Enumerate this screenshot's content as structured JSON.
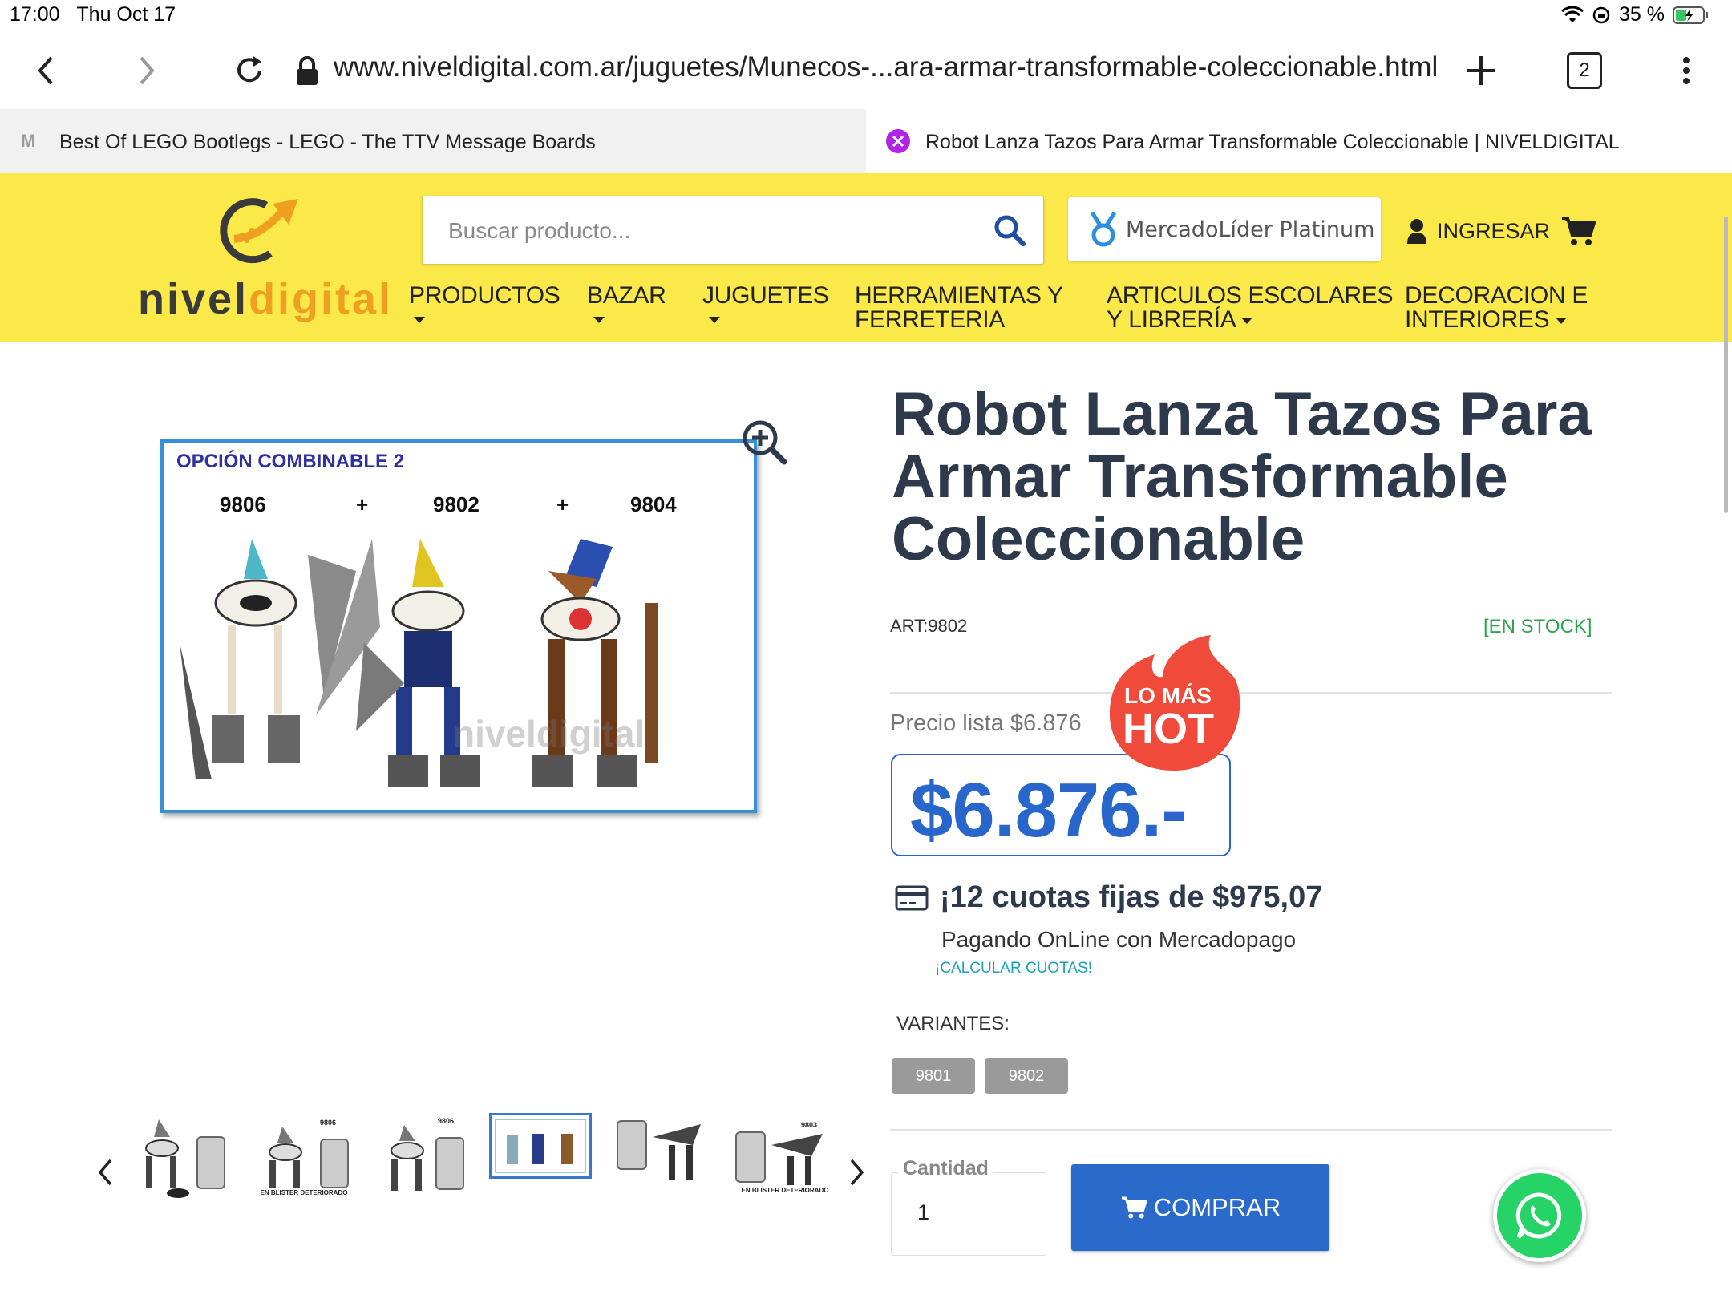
{
  "status_bar": {
    "time": "17:00",
    "date": "Thu Oct 17",
    "battery": "35 %"
  },
  "browser": {
    "url": "www.niveldigital.com.ar/juguetes/Munecos-...ara-armar-transformable-coleccionable.html",
    "tab_count": "2",
    "tabs": [
      {
        "title": "Best Of LEGO Bootlegs - LEGO - The TTV Message Boards",
        "favicon": "M"
      },
      {
        "title": "Robot Lanza Tazos Para Armar Transformable Coleccionable | NIVELDIGITAL"
      }
    ]
  },
  "header": {
    "logo": {
      "nivel": "nivel",
      "digital": "digital"
    },
    "search_placeholder": "Buscar producto...",
    "badge": "MercadoLíder Platinum",
    "login": "INGRESAR",
    "nav": [
      {
        "line1": "PRODUCTOS",
        "line2": ""
      },
      {
        "line1": "BAZAR",
        "line2": ""
      },
      {
        "line1": "JUGUETES",
        "line2": ""
      },
      {
        "line1": "HERRAMIENTAS Y",
        "line2": "FERRETERIA"
      },
      {
        "line1": "ARTICULOS ESCOLARES",
        "line2": "Y LIBRERÍA"
      },
      {
        "line1": "DECORACION E",
        "line2": "INTERIORES"
      }
    ]
  },
  "product": {
    "title": "Robot Lanza Tazos Para Armar Transformable Coleccionable",
    "art": "ART:9802",
    "stock": "[EN STOCK]",
    "list_price": "Precio lista $6.876",
    "hot_badge": {
      "top": "LO MÁS",
      "bottom": "HOT"
    },
    "price": "$6.876.-",
    "installments": "¡12 cuotas fijas de $975,07",
    "payment_note": "Pagando OnLine con Mercadopago",
    "calc_link": "¡CALCULAR CUOTAS!",
    "variants_label": "VARIANTES:",
    "variants": [
      "9801",
      "9802"
    ],
    "quantity_label": "Cantidad",
    "quantity": "1",
    "buy_label": "COMPRAR",
    "image": {
      "caption": "OPCIÓN COMBINABLE 2",
      "codes": [
        "9806",
        "9802",
        "9804"
      ],
      "plus": "+",
      "watermark": "niveldigital"
    },
    "thumbnails": [
      {
        "top": "",
        "note": ""
      },
      {
        "top": "9806",
        "note": "EN BLISTER DETERIORADO"
      },
      {
        "top": "9806",
        "note": ""
      },
      {
        "top": "",
        "note": "",
        "selected": true
      },
      {
        "top": "",
        "note": ""
      },
      {
        "top": "9803",
        "note": "EN BLISTER DETERIORADO"
      }
    ]
  },
  "colors": {
    "header_yellow": "#fbe94a",
    "price_blue": "#2966cc",
    "stock_green": "#2ea44f",
    "link_teal": "#17a2b8",
    "hot_red": "#f04b3a"
  }
}
